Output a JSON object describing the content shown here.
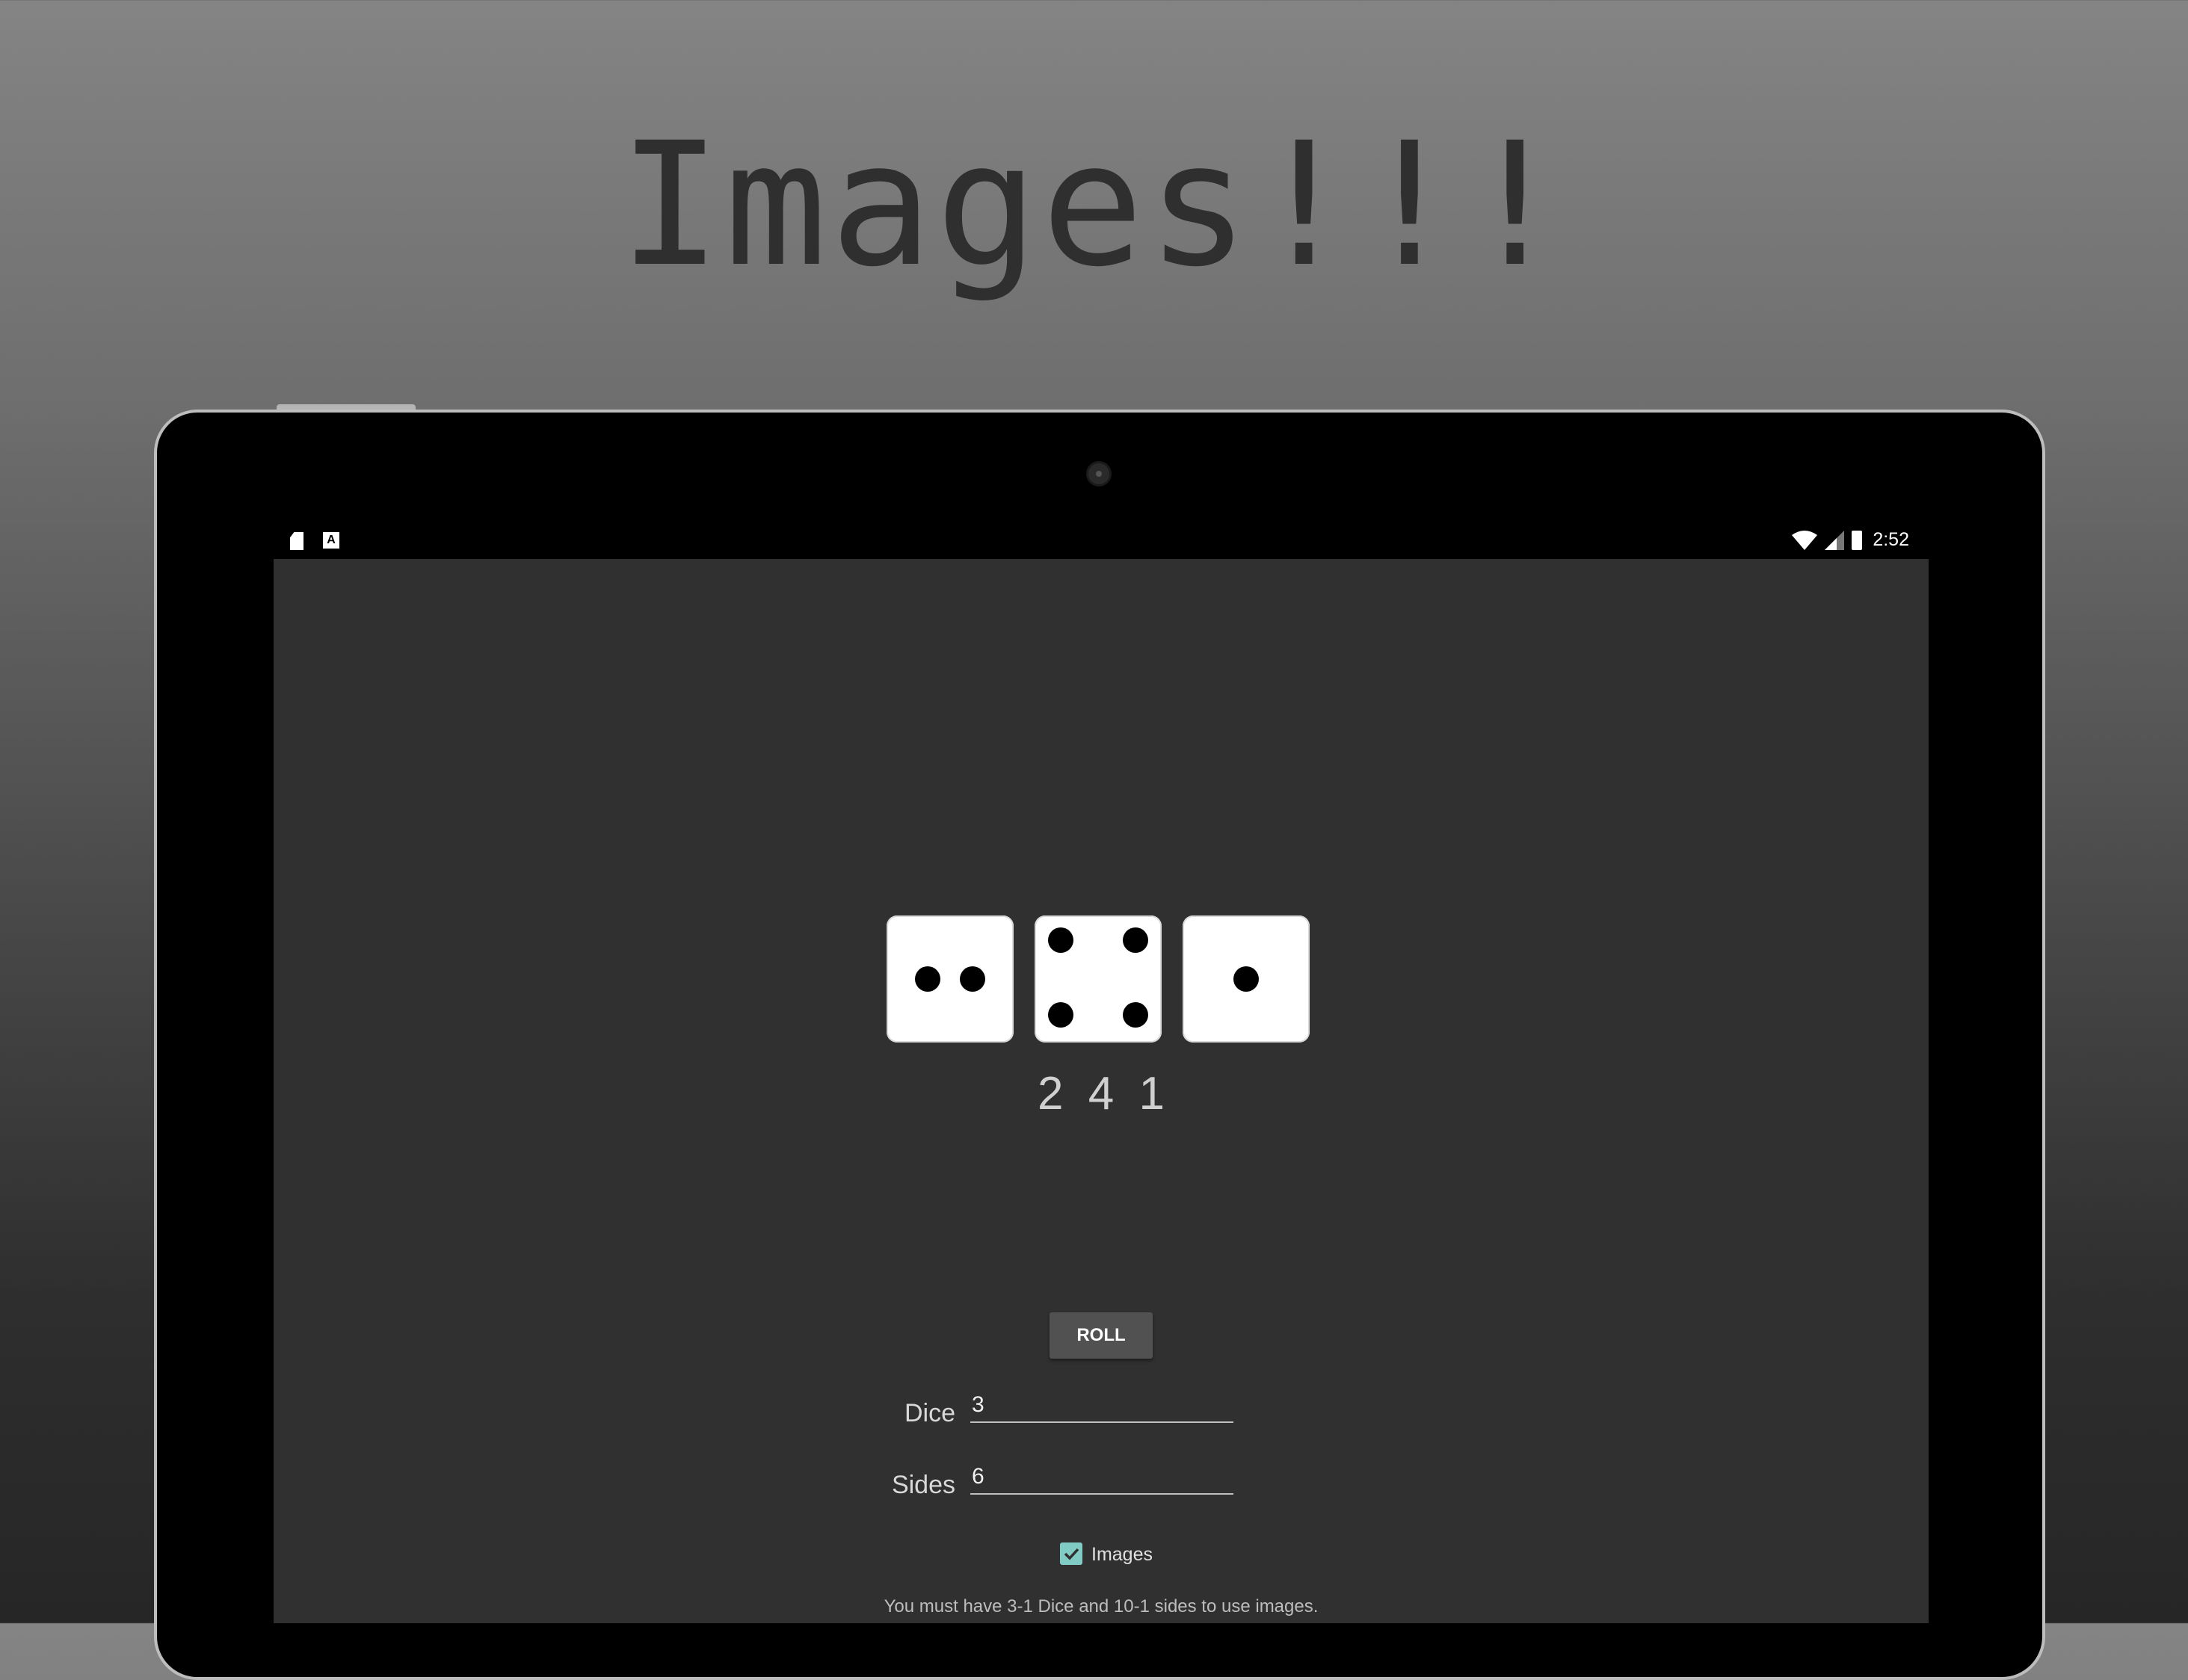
{
  "headline": "Images!!!",
  "status_bar": {
    "left_icons": [
      "sd-card-icon",
      "a-notification-icon"
    ],
    "right_icons": [
      "wifi-icon",
      "signal-icon",
      "battery-charging-icon"
    ],
    "time": "2:52"
  },
  "dice": {
    "faces": [
      2,
      4,
      1
    ],
    "results": [
      "2",
      "4",
      "1"
    ]
  },
  "controls": {
    "roll_label": "ROLL",
    "dice_label": "Dice",
    "dice_value": "3",
    "sides_label": "Sides",
    "sides_value": "6",
    "images_label": "Images",
    "images_checked": true
  },
  "note": "You must have 3-1  Dice and 10-1 sides to use images.",
  "colors": {
    "screen_bg": "#303030",
    "accent": "#80cbc4",
    "button_bg": "#515151"
  }
}
